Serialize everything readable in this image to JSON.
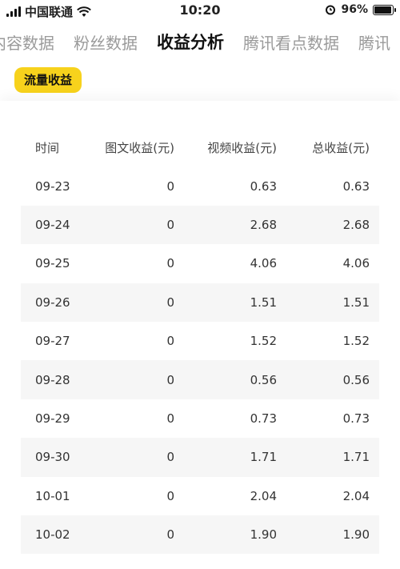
{
  "status_bar": {
    "carrier": "中国联通",
    "time": "10:20",
    "battery": "96%",
    "battery_level": 0.96,
    "icons": [
      "signal-icon",
      "wifi-icon",
      "alarm-icon",
      "battery-icon"
    ]
  },
  "tabs": [
    {
      "label": "内容数据",
      "active": false
    },
    {
      "label": "粉丝数据",
      "active": false
    },
    {
      "label": "收益分析",
      "active": true
    },
    {
      "label": "腾讯看点数据",
      "active": false
    },
    {
      "label": "腾讯",
      "active": false
    }
  ],
  "filter_pill": {
    "label": "流量收益",
    "color": "#f7d21c"
  },
  "table": {
    "headers": [
      "时间",
      "图文收益(元)",
      "视频收益(元)",
      "总收益(元)"
    ],
    "rows": [
      [
        "09-23",
        "0",
        "0.63",
        "0.63"
      ],
      [
        "09-24",
        "0",
        "2.68",
        "2.68"
      ],
      [
        "09-25",
        "0",
        "4.06",
        "4.06"
      ],
      [
        "09-26",
        "0",
        "1.51",
        "1.51"
      ],
      [
        "09-27",
        "0",
        "1.52",
        "1.52"
      ],
      [
        "09-28",
        "0",
        "0.56",
        "0.56"
      ],
      [
        "09-29",
        "0",
        "0.73",
        "0.73"
      ],
      [
        "09-30",
        "0",
        "1.71",
        "1.71"
      ],
      [
        "10-01",
        "0",
        "2.04",
        "2.04"
      ],
      [
        "10-02",
        "0",
        "1.90",
        "1.90"
      ]
    ]
  }
}
